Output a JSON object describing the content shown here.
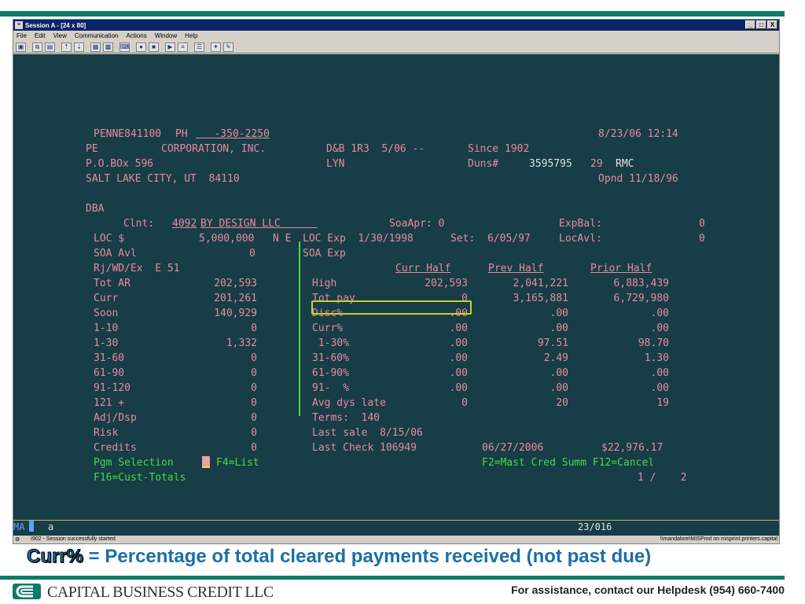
{
  "window": {
    "title": "Session A - [24 x 80]",
    "controls": [
      "_",
      "□",
      "X"
    ]
  },
  "menu": [
    "File",
    "Edit",
    "View",
    "Communication",
    "Actions",
    "Window",
    "Help"
  ],
  "terminal": {
    "r1_id": "PENNE841100",
    "r1_ph": "PH",
    "r1_phone": "   -350-2250",
    "r1_datetime": "8/23/06 12:14",
    "r2_name": "PE",
    "r2_corp": "CORPORATION, INC.",
    "r2_dnb": "D&B 1R3  5/06 --",
    "r2_since": "Since 1902",
    "r3_addr": "P.O.BOx 596",
    "r3_lyn": "LYN",
    "r3_duns_label": "Duns#",
    "r3_duns": "3595795",
    "r3_duns2": "29",
    "r3_rmc": "RMC",
    "r4_city": "SALT LAKE CITY, UT  84110",
    "r4_opnd": "Opnd 11/18/96",
    "dba": "DBA",
    "clnt_label": "Clnt:",
    "clnt_num": "4092",
    "clnt_name": "BY DESIGN LLC      ",
    "soaapr": "SoaApr: 0",
    "expbal_label": "ExpBal:",
    "expbal": "0",
    "loc_label": "LOC $",
    "loc_val": "5,000,000",
    "loc_ne": "N E",
    "locexp": "LOC Exp  1/30/1998",
    "set": "Set:  6/05/97",
    "locavl_label": "LocAvl:",
    "locavl": "0",
    "soaavl_label": "SOA Avl",
    "soaavl": "0",
    "soaexp": "SOA Exp",
    "rjwdex": "Rj/WD/Ex  E 51",
    "hdr_curr": "Curr Half",
    "hdr_prev": "Prev Half",
    "hdr_prior": "Prior Half",
    "left_rows": [
      {
        "label": "Tot AR",
        "value": "202,593"
      },
      {
        "label": "Curr",
        "value": "201,261"
      },
      {
        "label": "Soon",
        "value": "140,929"
      },
      {
        "label": "1-10",
        "value": "0"
      },
      {
        "label": "1-30",
        "value": "1,332"
      },
      {
        "label": "31-60",
        "value": "0"
      },
      {
        "label": "61-90",
        "value": "0"
      },
      {
        "label": "91-120",
        "value": "0"
      },
      {
        "label": "121 +",
        "value": "0"
      },
      {
        "label": "Adj/Dsp",
        "value": "0"
      },
      {
        "label": "Risk",
        "value": "0"
      },
      {
        "label": "Credits",
        "value": "0"
      }
    ],
    "right_rows": [
      {
        "label": "High",
        "curr": "202,593",
        "prev": "2,041,221",
        "prior": "6,883,439"
      },
      {
        "label": "Tot pay",
        "curr": "0",
        "prev": "3,165,881",
        "prior": "6,729,980"
      },
      {
        "label": "Disc%",
        "curr": ".00",
        "prev": ".00",
        "prior": ".00"
      },
      {
        "label": "Curr%",
        "curr": ".00",
        "prev": ".00",
        "prior": ".00"
      },
      {
        "label": " 1-30%",
        "curr": ".00",
        "prev": "97.51",
        "prior": "98.70"
      },
      {
        "label": "31-60%",
        "curr": ".00",
        "prev": "2.49",
        "prior": "1.30"
      },
      {
        "label": "61-90%",
        "curr": ".00",
        "prev": ".00",
        "prior": ".00"
      },
      {
        "label": "91-  %",
        "curr": ".00",
        "prev": ".00",
        "prior": ".00"
      },
      {
        "label": "Avg dys late",
        "curr": "0",
        "prev": "20",
        "prior": "19"
      }
    ],
    "terms": "Terms:  140",
    "last_sale": "Last sale  8/15/06",
    "last_check": "Last Check 106949",
    "check_date": "06/27/2006",
    "check_amt": "$22,976.17",
    "pgm_selection": "Pgm Selection",
    "f4": "F4=List",
    "f2f12": "F2=Mast Cred Summ F12=Cancel",
    "f16": "F16=Cust-Totals",
    "page": "1 /    2"
  },
  "oia": {
    "ma": "MA",
    "a": "a",
    "cursor_pos": "23/016"
  },
  "status": {
    "message": "I902 - Session successfully started",
    "printer": "\\\\mandalore\\MISPrint on misprint.printers.capital"
  },
  "caption": {
    "term": "Curr%",
    "definition": " = Percentage of total cleared payments received (not past due)"
  },
  "footer": {
    "company": "CAPITAL BUSINESS CREDIT LLC",
    "help": "For assistance, contact our Helpdesk (954) 660-7400"
  },
  "colors": {
    "terminal_bg": "#173d46",
    "field_pink": "#e88aa0",
    "field_blue": "#8c9cff",
    "field_green": "#48d848",
    "caption_blue": "#1a6fa8",
    "stripe_teal": "#0f7a6a"
  }
}
